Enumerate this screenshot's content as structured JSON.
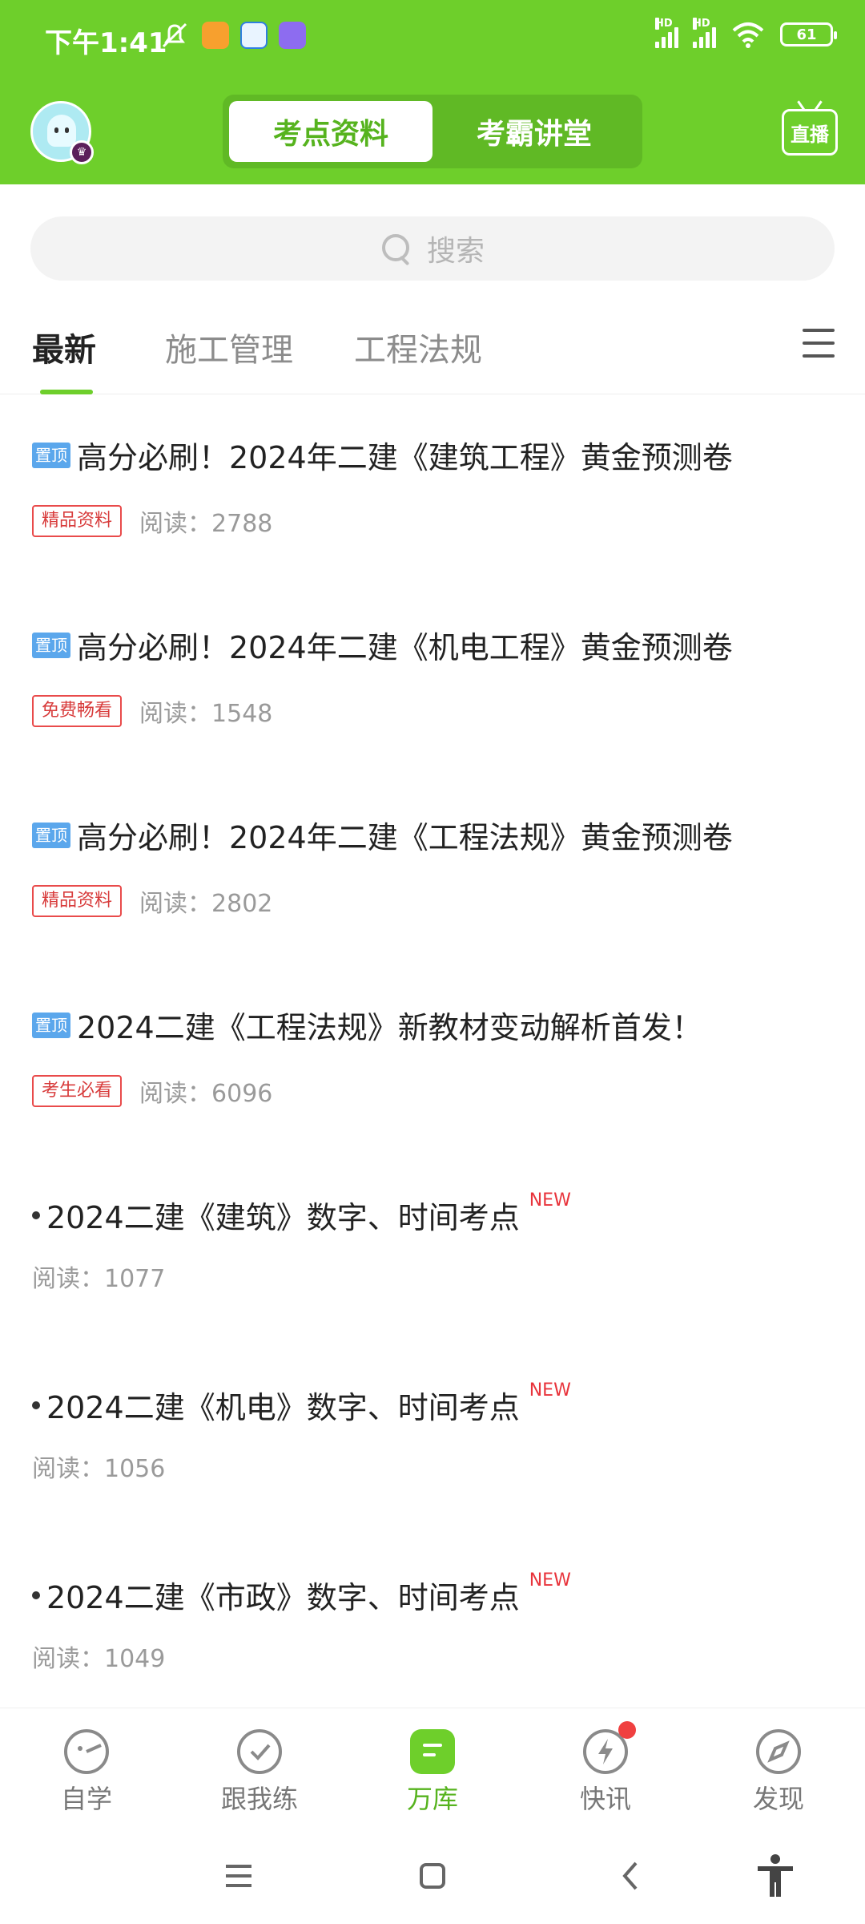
{
  "status_bar": {
    "time": "下午1:41",
    "battery": "61",
    "hd_label": "HD"
  },
  "header": {
    "tabs": [
      {
        "label": "考点资料",
        "active": true
      },
      {
        "label": "考霸讲堂",
        "active": false
      }
    ],
    "live_label": "直播"
  },
  "search": {
    "placeholder": "搜索"
  },
  "categories": [
    {
      "label": "最新",
      "active": true
    },
    {
      "label": "施工管理",
      "active": false
    },
    {
      "label": "工程法规",
      "active": false
    }
  ],
  "articles": [
    {
      "pinned": true,
      "pin_label": "置顶",
      "title": "高分必刷！2024年二建《建筑工程》黄金预测卷",
      "tag": "精品资料",
      "reads": "阅读：2788"
    },
    {
      "pinned": true,
      "pin_label": "置顶",
      "title": "高分必刷！2024年二建《机电工程》黄金预测卷",
      "tag": "免费畅看",
      "reads": "阅读：1548"
    },
    {
      "pinned": true,
      "pin_label": "置顶",
      "title": "高分必刷！2024年二建《工程法规》黄金预测卷",
      "tag": "精品资料",
      "reads": "阅读：2802"
    },
    {
      "pinned": true,
      "pin_label": "置顶",
      "title": "2024二建《工程法规》新教材变动解析首发！",
      "tag": "考生必看",
      "reads": "阅读：6096"
    },
    {
      "pinned": false,
      "title": "2024二建《建筑》数字、时间考点",
      "new_label": "NEW",
      "reads": "阅读：1077"
    },
    {
      "pinned": false,
      "title": "2024二建《机电》数字、时间考点",
      "new_label": "NEW",
      "reads": "阅读：1056"
    },
    {
      "pinned": false,
      "title": "2024二建《市政》数字、时间考点",
      "new_label": "NEW",
      "reads": "阅读：1049"
    }
  ],
  "bottom_nav": [
    {
      "label": "自学",
      "icon": "self-study-icon",
      "active": false
    },
    {
      "label": "跟我练",
      "icon": "check-circle-icon",
      "active": false
    },
    {
      "label": "万库",
      "icon": "library-icon",
      "active": true
    },
    {
      "label": "快讯",
      "icon": "lightning-icon",
      "active": false,
      "badge": true
    },
    {
      "label": "发现",
      "icon": "compass-icon",
      "active": false
    }
  ],
  "colors": {
    "brand_green": "#6ecf2b",
    "pin_blue": "#5ba7ec",
    "tag_red": "#e94b4b"
  }
}
